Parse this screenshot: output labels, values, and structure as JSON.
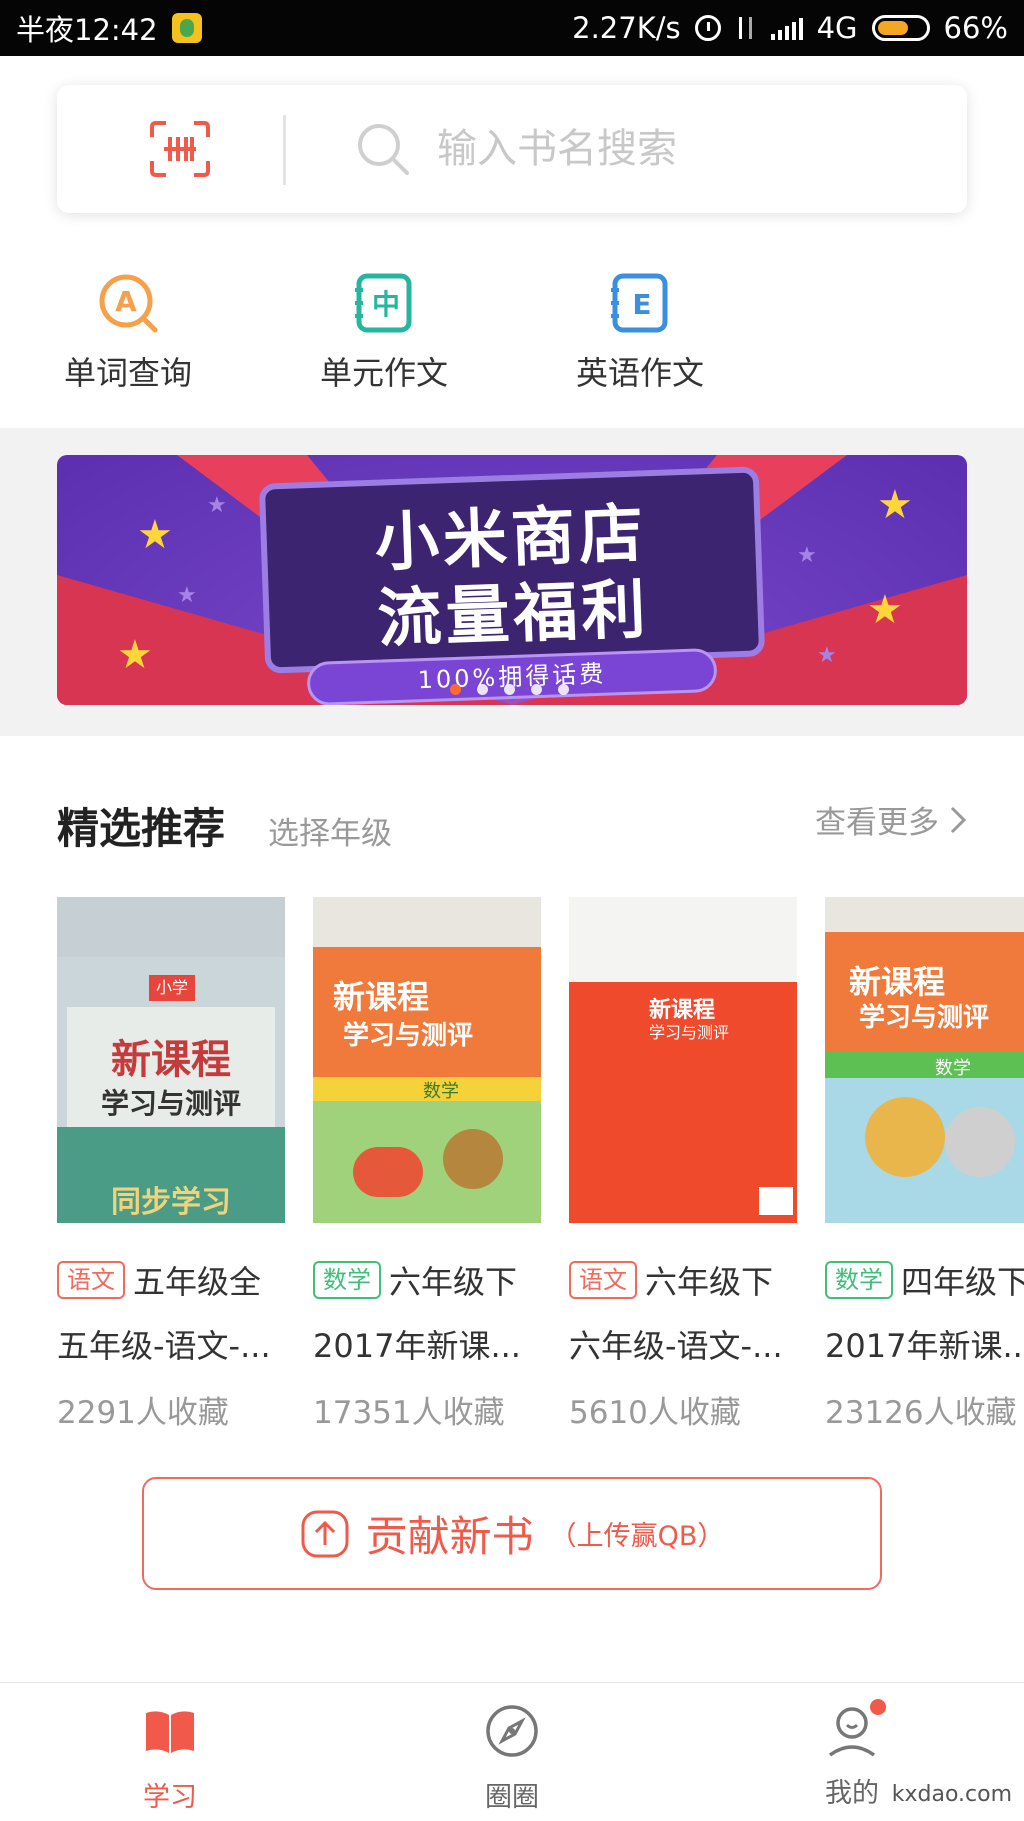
{
  "status_bar": {
    "time": "半夜12:42",
    "speed": "2.27K/s",
    "network": "4G",
    "battery": "66%",
    "battery_level": 0.66
  },
  "search": {
    "placeholder": "输入书名搜索",
    "scan_icon": "barcode-scan-icon",
    "search_icon": "search-icon"
  },
  "tools": [
    {
      "label": "单词查询",
      "icon": "word-lookup-icon",
      "color": "#f5a04a"
    },
    {
      "label": "单元作文",
      "icon": "unit-essay-icon",
      "color": "#25b6a0"
    },
    {
      "label": "英语作文",
      "icon": "english-essay-icon",
      "color": "#3a8fe0"
    }
  ],
  "banner": {
    "title_line1": "小米商店",
    "title_line2": "流量福利",
    "subtitle": "100%拥得话费",
    "slide_count": 5,
    "active_index": 0
  },
  "section": {
    "title": "精选推荐",
    "subtitle": "选择年级",
    "more": "查看更多"
  },
  "books": [
    {
      "subject": "语文",
      "title": "五年级全",
      "desc": "五年级-语文-...",
      "favorites": "2291人收藏",
      "tag_color": "#f26a5a",
      "cover_title": "新课程",
      "cover_sub": "学习与测评",
      "cover_band": "同步学习",
      "cover_badge": "小学"
    },
    {
      "subject": "数学",
      "title": "六年级下",
      "desc": "2017年新课...",
      "favorites": "17351人收藏",
      "tag_color": "#3fbf7a",
      "cover_title": "新课程",
      "cover_sub": "学习与测评",
      "cover_band": "数学"
    },
    {
      "subject": "语文",
      "title": "六年级下",
      "desc": "六年级-语文-...",
      "favorites": "5610人收藏",
      "tag_color": "#f26a5a",
      "cover_title": "新课程",
      "cover_sub": "学习与测评"
    },
    {
      "subject": "数学",
      "title": "四年级下",
      "desc": "2017年新课...",
      "favorites": "23126人收藏",
      "tag_color": "#3fbf7a",
      "cover_title": "新课程",
      "cover_sub": "学习与测评",
      "cover_band": "数学"
    }
  ],
  "contribute": {
    "label": "贡献新书",
    "sub": "（上传赢QB）",
    "icon": "upload-icon"
  },
  "bottom_nav": [
    {
      "label": "学习",
      "icon": "book-icon",
      "active": true
    },
    {
      "label": "圈圈",
      "icon": "compass-icon",
      "active": false
    },
    {
      "label": "我的",
      "icon": "profile-icon",
      "active": false,
      "has_badge": true
    }
  ],
  "watermark": "kxdao.com",
  "accent": "#f15a4a"
}
